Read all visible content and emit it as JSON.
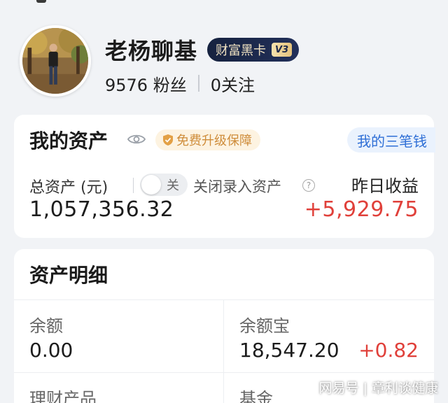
{
  "profile": {
    "username": "老杨聊基",
    "badge": "财富黑卡",
    "badge_level": "V3",
    "fans_count": "9576",
    "fans_label": "粉丝",
    "follow_count": "0",
    "follow_label": "关注"
  },
  "assets": {
    "title": "我的资产",
    "upgrade_label": "免费升级保障",
    "three_money_label": "我的三笔钱",
    "total_label": "总资产 (元)",
    "toggle_label": "关",
    "close_entry_label": "关闭录入资产",
    "help_symbol": "?",
    "yesterday_label": "昨日收益",
    "total_value": "1,057,356.32",
    "yesterday_value": "+5,929.75"
  },
  "detail": {
    "title": "资产明细",
    "cells": [
      {
        "label": "余额",
        "value": "0.00",
        "change": ""
      },
      {
        "label": "余额宝",
        "value": "18,547.20",
        "change": "+0.82"
      },
      {
        "label": "理财产品",
        "value": "",
        "change": ""
      },
      {
        "label": "基金",
        "value": "",
        "change": ""
      }
    ]
  },
  "watermark": "网易号 | 章利谈健康",
  "colors": {
    "accent_red": "#e0403a",
    "accent_blue": "#2f6fd6",
    "badge_bg": "#16223f",
    "upgrade_text": "#cf8d3b"
  },
  "icons": [
    "eye-icon",
    "shield-check-icon",
    "help-icon"
  ]
}
